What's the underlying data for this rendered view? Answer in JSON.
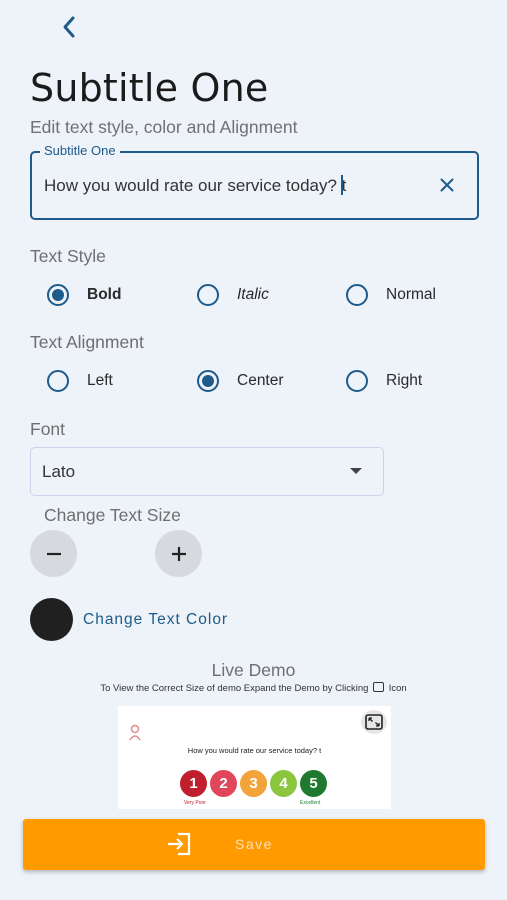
{
  "header": {
    "back_icon": "chevron-left-icon",
    "title": "Subtitle One",
    "subtitle": "Edit text style, color and Alignment"
  },
  "subtitle_field": {
    "label": "Subtitle One",
    "value": "How you would rate our service today? t",
    "clear_icon": "close-icon"
  },
  "text_style": {
    "label": "Text Style",
    "options": [
      {
        "label": "Bold",
        "selected": true
      },
      {
        "label": "Italic",
        "selected": false
      },
      {
        "label": "Normal",
        "selected": false
      }
    ]
  },
  "text_alignment": {
    "label": "Text Alignment",
    "options": [
      {
        "label": "Left",
        "selected": false
      },
      {
        "label": "Center",
        "selected": true
      },
      {
        "label": "Right",
        "selected": false
      }
    ]
  },
  "font": {
    "label": "Font",
    "selected": "Lato"
  },
  "text_size": {
    "label": "Change Text Size",
    "decrease_icon": "minus-icon",
    "increase_icon": "plus-icon"
  },
  "text_color": {
    "label": "Change Text Color",
    "swatch_color": "#202020"
  },
  "live_demo": {
    "title": "Live Demo",
    "hint_before": "To View the Correct Size of demo Expand the Demo by Clicking",
    "hint_after": "Icon",
    "question": "How you would rate our service today? t",
    "ratings": [
      {
        "label": "1",
        "color": "#c0202e"
      },
      {
        "label": "2",
        "color": "#e0475a"
      },
      {
        "label": "3",
        "color": "#f2a33a"
      },
      {
        "label": "4",
        "color": "#8cc63f"
      },
      {
        "label": "5",
        "color": "#1f7a30"
      }
    ],
    "low_label": "Very Poor",
    "high_label": "Excellent"
  },
  "save": {
    "label": "Save",
    "icon": "sign-in-icon",
    "color": "#ff9a00"
  }
}
